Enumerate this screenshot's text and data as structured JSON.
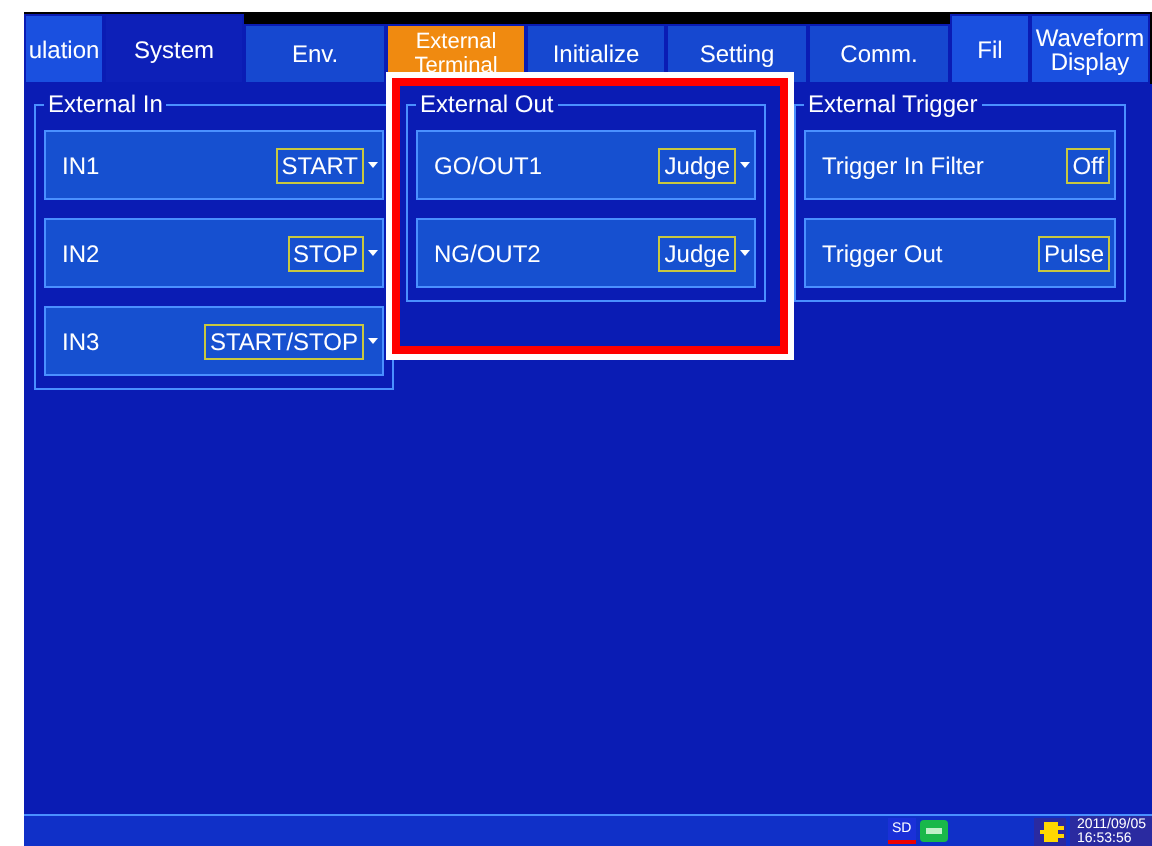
{
  "tabs": [
    {
      "label": "ulation",
      "kind": "category",
      "selected": false
    },
    {
      "label": "System",
      "kind": "category",
      "selected": true
    },
    {
      "label": "Env.",
      "kind": "sub",
      "selected": false
    },
    {
      "label": "External Terminal",
      "kind": "sub",
      "selected": true
    },
    {
      "label": "Initialize",
      "kind": "sub",
      "selected": false
    },
    {
      "label": "Setting",
      "kind": "sub",
      "selected": false
    },
    {
      "label": "Comm.",
      "kind": "sub",
      "selected": false
    },
    {
      "label": "Fil",
      "kind": "category",
      "selected": false
    },
    {
      "label": "Waveform Display",
      "kind": "category",
      "selected": false
    }
  ],
  "groups": [
    {
      "title": "External In",
      "highlighted": false,
      "rows": [
        {
          "label": "IN1",
          "value": "START",
          "dropdown": true
        },
        {
          "label": "IN2",
          "value": "STOP",
          "dropdown": true
        },
        {
          "label": "IN3",
          "value": "START/STOP",
          "dropdown": true
        }
      ]
    },
    {
      "title": "External Out",
      "highlighted": true,
      "rows": [
        {
          "label": "GO/OUT1",
          "value": "Judge",
          "dropdown": true
        },
        {
          "label": "NG/OUT2",
          "value": "Judge",
          "dropdown": true
        }
      ]
    },
    {
      "title": "External Trigger",
      "highlighted": false,
      "rows": [
        {
          "label": "Trigger In Filter",
          "value": "Off",
          "dropdown": false
        },
        {
          "label": "Trigger Out",
          "value": "Pulse",
          "dropdown": false
        }
      ]
    }
  ],
  "status_bar": {
    "sd_label": "SD",
    "date": "2011/09/05",
    "time": "16:53:56"
  }
}
